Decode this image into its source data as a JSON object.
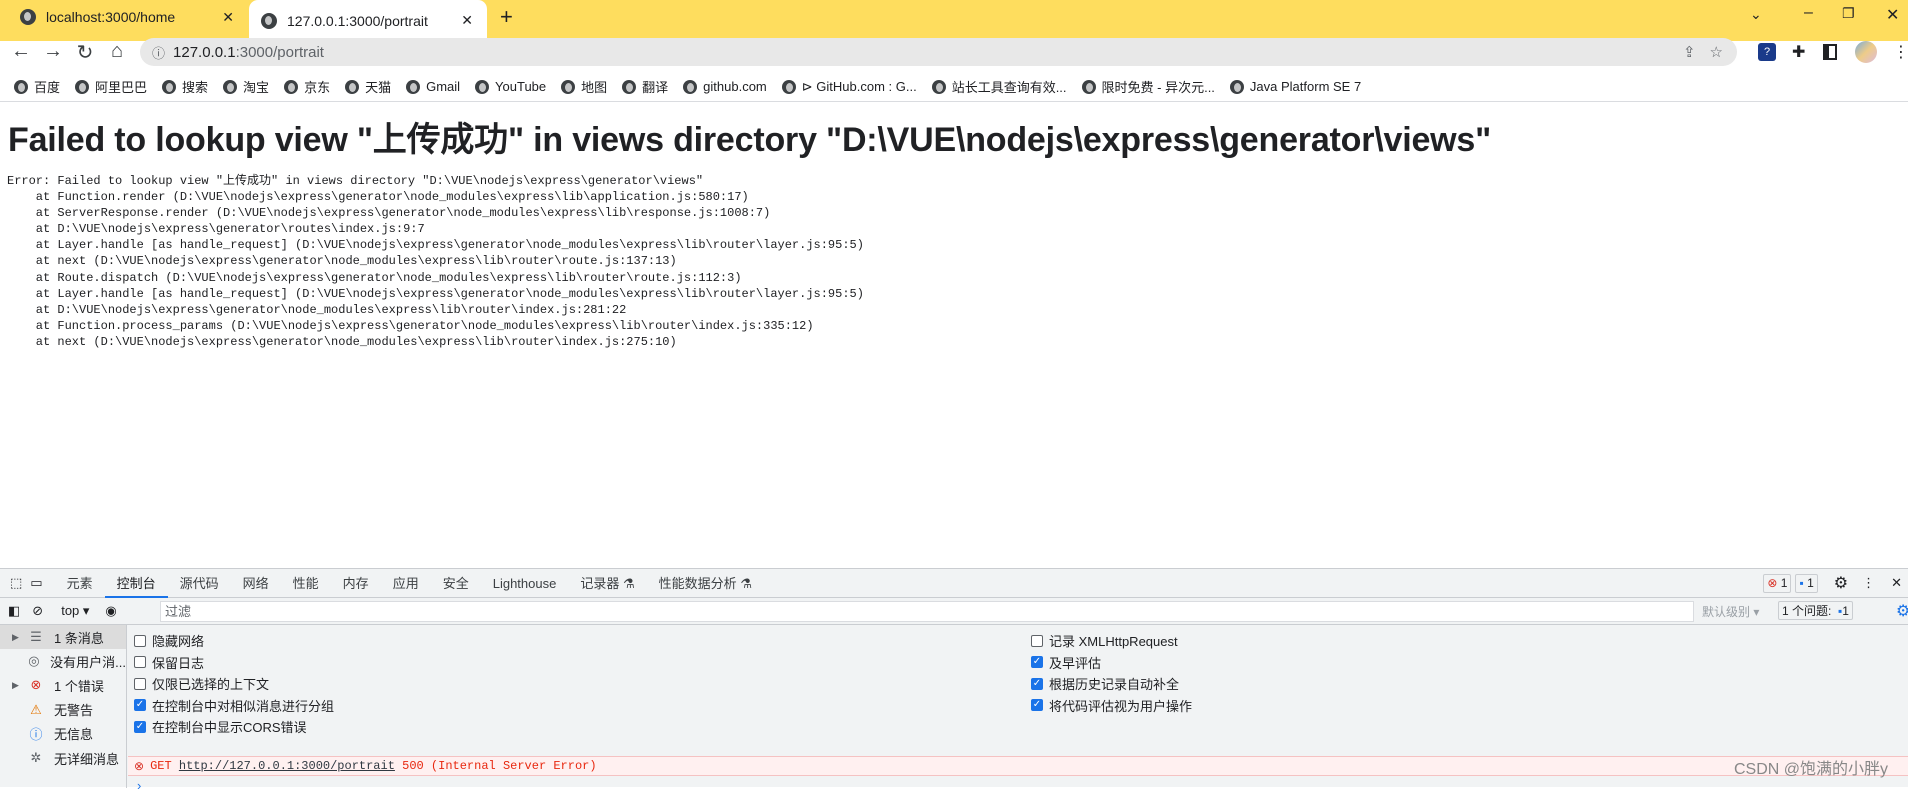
{
  "browser": {
    "tabs": [
      {
        "title": "localhost:3000/home",
        "active": false
      },
      {
        "title": "127.0.0.1:3000/portrait",
        "active": true
      }
    ],
    "url_host": "127.0.0.1",
    "url_rest": ":3000/portrait",
    "bookmarks": [
      "百度",
      "阿里巴巴",
      "搜索",
      "淘宝",
      "京东",
      "天猫",
      "Gmail",
      "YouTube",
      "地图",
      "翻译",
      "github.com",
      "⊳ GitHub.com : G...",
      "站长工具查询有效...",
      "限时免费 - 异次元...",
      "Java Platform SE 7"
    ],
    "accent": "#fedd5e"
  },
  "page": {
    "heading": "Failed to lookup view \"上传成功\" in views directory \"D:\\VUE\\nodejs\\express\\generator\\views\"",
    "stack": "Error: Failed to lookup view \"上传成功\" in views directory \"D:\\VUE\\nodejs\\express\\generator\\views\"\n    at Function.render (D:\\VUE\\nodejs\\express\\generator\\node_modules\\express\\lib\\application.js:580:17)\n    at ServerResponse.render (D:\\VUE\\nodejs\\express\\generator\\node_modules\\express\\lib\\response.js:1008:7)\n    at D:\\VUE\\nodejs\\express\\generator\\routes\\index.js:9:7\n    at Layer.handle [as handle_request] (D:\\VUE\\nodejs\\express\\generator\\node_modules\\express\\lib\\router\\layer.js:95:5)\n    at next (D:\\VUE\\nodejs\\express\\generator\\node_modules\\express\\lib\\router\\route.js:137:13)\n    at Route.dispatch (D:\\VUE\\nodejs\\express\\generator\\node_modules\\express\\lib\\router\\route.js:112:3)\n    at Layer.handle [as handle_request] (D:\\VUE\\nodejs\\express\\generator\\node_modules\\express\\lib\\router\\layer.js:95:5)\n    at D:\\VUE\\nodejs\\express\\generator\\node_modules\\express\\lib\\router\\index.js:281:22\n    at Function.process_params (D:\\VUE\\nodejs\\express\\generator\\node_modules\\express\\lib\\router\\index.js:335:12)\n    at next (D:\\VUE\\nodejs\\express\\generator\\node_modules\\express\\lib\\router\\index.js:275:10)"
  },
  "devtools": {
    "tabs": [
      "元素",
      "控制台",
      "源代码",
      "网络",
      "性能",
      "内存",
      "应用",
      "安全",
      "Lighthouse",
      "记录器 ⚗",
      "性能数据分析 ⚗"
    ],
    "active_tab": "控制台",
    "error_count": "1",
    "message_count": "1",
    "context": "top",
    "filter_placeholder": "过滤",
    "level": "默认级别 ▾",
    "issues_label": "1 个问题:",
    "issues_count": "1",
    "sidebar": [
      {
        "label": "1 条消息",
        "icon": "list-icon"
      },
      {
        "label": "没有用户消...",
        "icon": "user-icon"
      },
      {
        "label": "1 个错误",
        "icon": "error-icon"
      },
      {
        "label": "无警告",
        "icon": "warning-icon"
      },
      {
        "label": "无信息",
        "icon": "info-icon"
      },
      {
        "label": "无详细消息",
        "icon": "bug-icon"
      }
    ],
    "options_left": [
      {
        "label": "隐藏网络",
        "checked": false
      },
      {
        "label": "保留日志",
        "checked": false
      },
      {
        "label": "仅限已选择的上下文",
        "checked": false
      },
      {
        "label": "在控制台中对相似消息进行分组",
        "checked": true
      },
      {
        "label": "在控制台中显示CORS错误",
        "checked": true
      }
    ],
    "options_right": [
      {
        "label": "记录 XMLHttpRequest",
        "checked": false
      },
      {
        "label": "及早评估",
        "checked": true
      },
      {
        "label": "根据历史记录自动补全",
        "checked": true
      },
      {
        "label": "将代码评估视为用户操作",
        "checked": true
      }
    ],
    "error": {
      "method": "GET",
      "url": "http://127.0.0.1:3000/portrait",
      "status": "500 (Internal Server Error)"
    },
    "prompt": "›"
  },
  "watermark": "CSDN @饱满的小胖y"
}
